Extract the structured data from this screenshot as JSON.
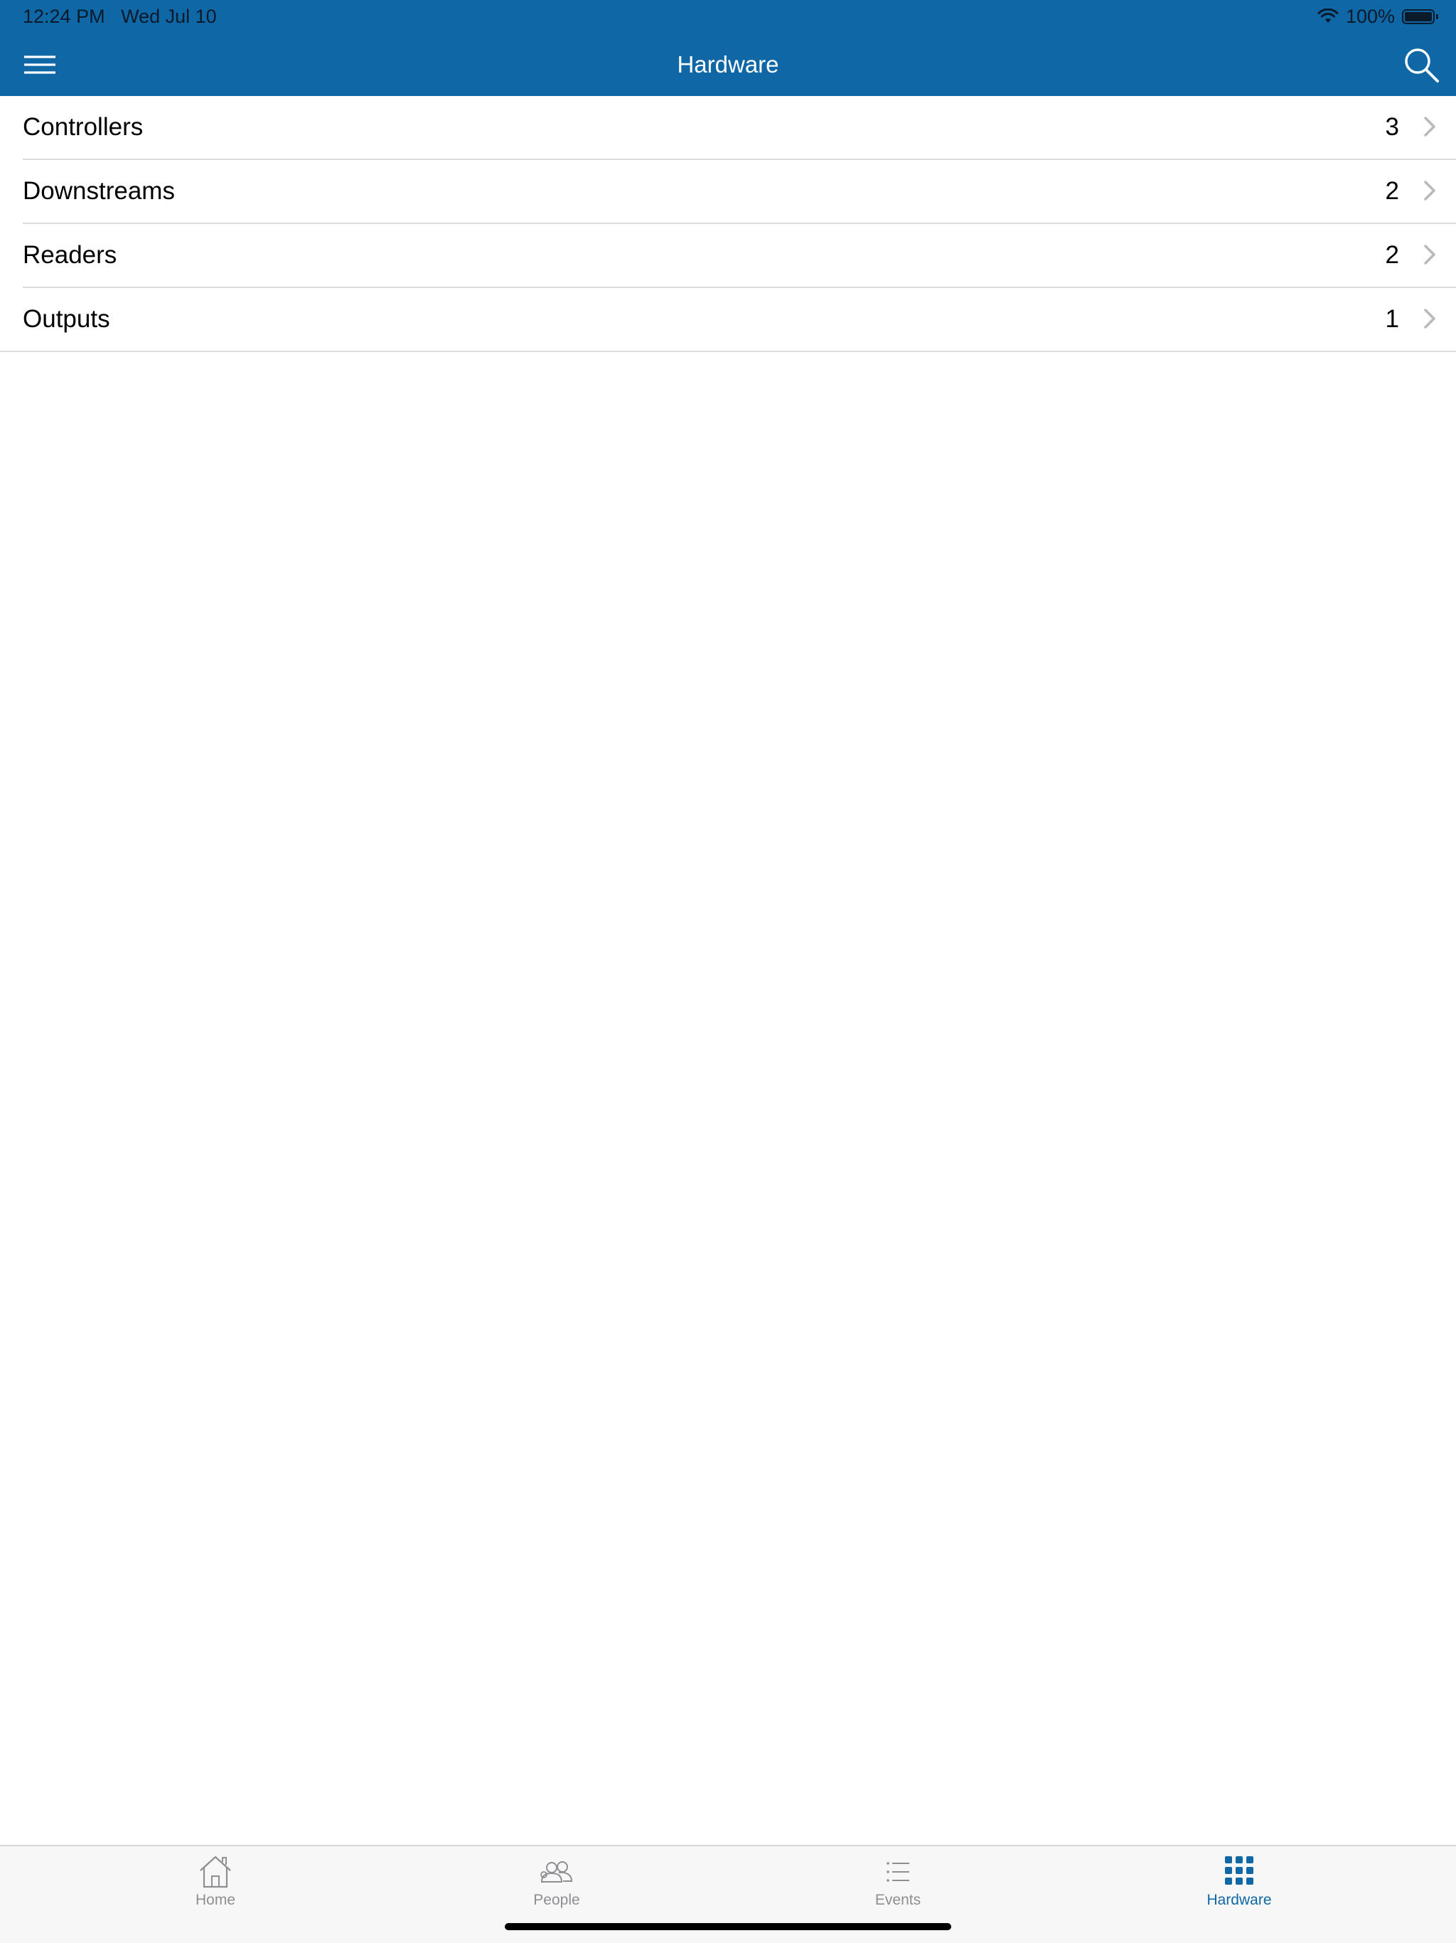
{
  "status_bar": {
    "time_date": "12:24 PM   Wed Jul 10",
    "battery_percent": "100%",
    "battery_level": 1.0,
    "wifi_icon": "wifi-icon",
    "battery_icon": "battery-icon"
  },
  "nav": {
    "title": "Hardware",
    "menu_icon": "hamburger-menu-icon",
    "search_icon": "search-icon"
  },
  "list": {
    "items": [
      {
        "label": "Controllers",
        "count": "3"
      },
      {
        "label": "Downstreams",
        "count": "2"
      },
      {
        "label": "Readers",
        "count": "2"
      },
      {
        "label": "Outputs",
        "count": "1"
      }
    ]
  },
  "tabbar": {
    "tabs": [
      {
        "label": "Home",
        "icon": "home-icon",
        "active": false
      },
      {
        "label": "People",
        "icon": "people-icon",
        "active": false
      },
      {
        "label": "Events",
        "icon": "list-icon",
        "active": false
      },
      {
        "label": "Hardware",
        "icon": "grid-icon",
        "active": true
      }
    ]
  },
  "colors": {
    "brand_blue": "#0f67a5",
    "tab_inactive": "#8e8e93",
    "divider": "#dcdcdc"
  }
}
